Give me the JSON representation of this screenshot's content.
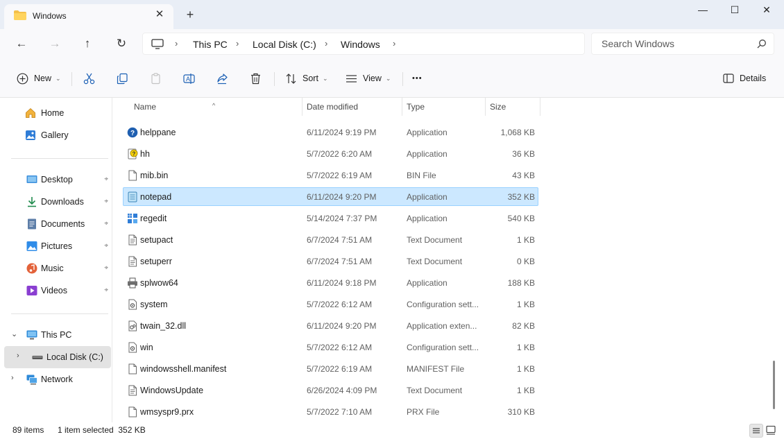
{
  "window": {
    "tab_title": "Windows",
    "tab_close": "✕",
    "new_tab": "+",
    "minimize": "—",
    "maximize": "☐",
    "close": "✕"
  },
  "navigation": {
    "back": "←",
    "forward": "→",
    "up": "↑",
    "refresh": "↻",
    "breadcrumb": [
      "This PC",
      "Local Disk (C:)",
      "Windows"
    ],
    "separator": "›",
    "search_placeholder": "Search Windows"
  },
  "toolbar": {
    "new_label": "New",
    "sort_label": "Sort",
    "view_label": "View",
    "more_label": "•••",
    "details_label": "Details",
    "caret": "⌄"
  },
  "sidebar": {
    "items": [
      {
        "label": "Home"
      },
      {
        "label": "Gallery"
      },
      {
        "label": "Desktop"
      },
      {
        "label": "Downloads"
      },
      {
        "label": "Documents"
      },
      {
        "label": "Pictures"
      },
      {
        "label": "Music"
      },
      {
        "label": "Videos"
      },
      {
        "label": "This PC"
      },
      {
        "label": "Local Disk (C:)"
      },
      {
        "label": "Network"
      }
    ],
    "pin_glyph": "📌",
    "chevron_open": "⌄",
    "chevron_closed": "›"
  },
  "columns": {
    "name": "Name",
    "date": "Date modified",
    "type": "Type",
    "size": "Size",
    "sort_arrow": "^"
  },
  "files": [
    {
      "name": "helppane",
      "date": "6/11/2024 9:19 PM",
      "type": "Application",
      "size": "1,068 KB",
      "icon": "help-icon"
    },
    {
      "name": "hh",
      "date": "5/7/2022 6:20 AM",
      "type": "Application",
      "size": "36 KB",
      "icon": "help-doc-icon"
    },
    {
      "name": "mib.bin",
      "date": "5/7/2022 6:19 AM",
      "type": "BIN File",
      "size": "43 KB",
      "icon": "file-icon"
    },
    {
      "name": "notepad",
      "date": "6/11/2024 9:20 PM",
      "type": "Application",
      "size": "352 KB",
      "icon": "notepad-icon"
    },
    {
      "name": "regedit",
      "date": "5/14/2024 7:37 PM",
      "type": "Application",
      "size": "540 KB",
      "icon": "registry-icon"
    },
    {
      "name": "setupact",
      "date": "6/7/2024 7:51 AM",
      "type": "Text Document",
      "size": "1 KB",
      "icon": "text-file-icon"
    },
    {
      "name": "setuperr",
      "date": "6/7/2024 7:51 AM",
      "type": "Text Document",
      "size": "0 KB",
      "icon": "text-file-icon"
    },
    {
      "name": "splwow64",
      "date": "6/11/2024 9:18 PM",
      "type": "Application",
      "size": "188 KB",
      "icon": "printer-icon"
    },
    {
      "name": "system",
      "date": "5/7/2022 6:12 AM",
      "type": "Configuration sett...",
      "size": "1 KB",
      "icon": "config-file-icon"
    },
    {
      "name": "twain_32.dll",
      "date": "6/11/2024 9:20 PM",
      "type": "Application exten...",
      "size": "82 KB",
      "icon": "dll-file-icon"
    },
    {
      "name": "win",
      "date": "5/7/2022 6:12 AM",
      "type": "Configuration sett...",
      "size": "1 KB",
      "icon": "config-file-icon"
    },
    {
      "name": "windowsshell.manifest",
      "date": "5/7/2022 6:19 AM",
      "type": "MANIFEST File",
      "size": "1 KB",
      "icon": "file-icon"
    },
    {
      "name": "WindowsUpdate",
      "date": "6/26/2024 4:09 PM",
      "type": "Text Document",
      "size": "1 KB",
      "icon": "text-file-icon"
    },
    {
      "name": "wmsyspr9.prx",
      "date": "5/7/2022 7:10 AM",
      "type": "PRX File",
      "size": "310 KB",
      "icon": "file-icon"
    }
  ],
  "selected_file": "notepad",
  "status": {
    "items": "89 items",
    "selection": "1 item selected  352 KB"
  },
  "colors": {
    "selection_bg": "#cce8ff",
    "selection_border": "#99d1ff",
    "chrome_bg": "#f9f9fb",
    "titlebar_bg": "#e9eef6"
  }
}
